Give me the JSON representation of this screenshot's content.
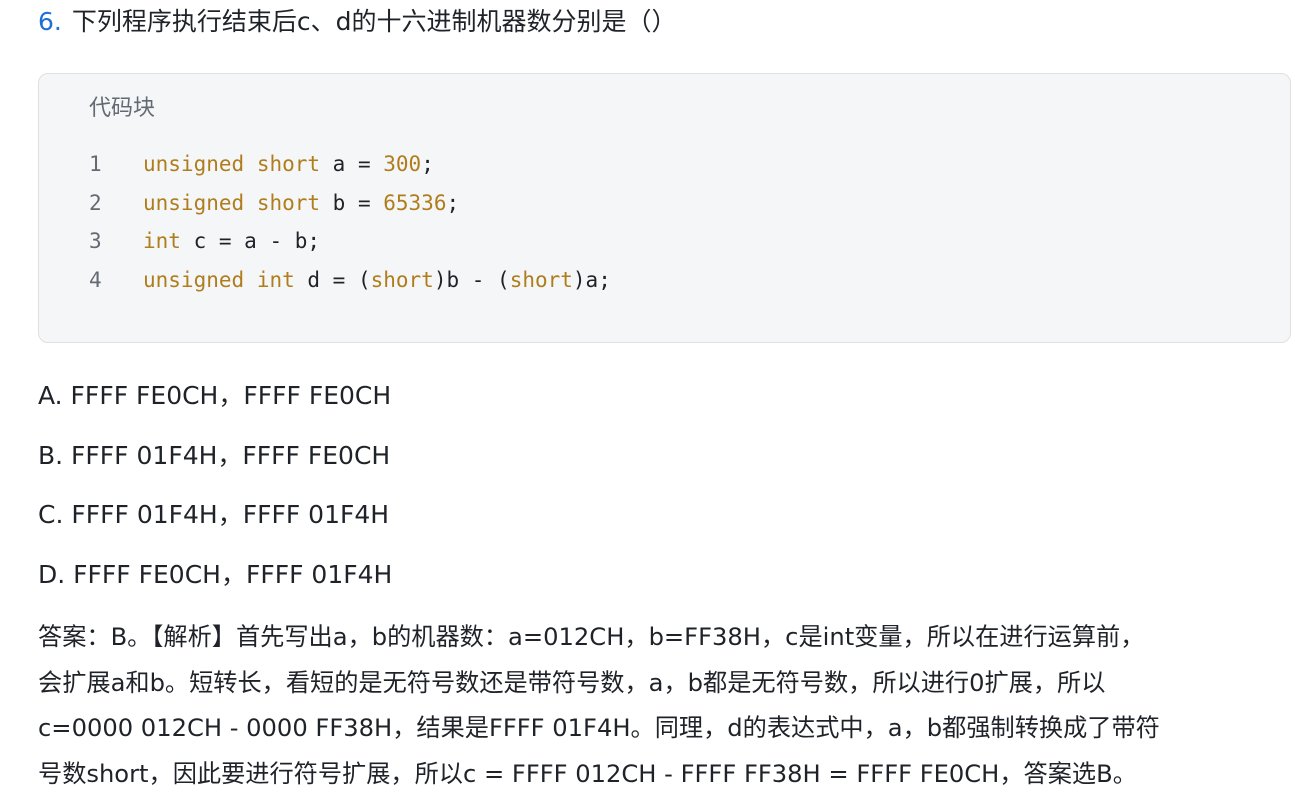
{
  "question": {
    "number": "6.",
    "text": "下列程序执行结束后c、d的十六进制机器数分别是（）"
  },
  "code_block": {
    "title": "代码块",
    "lines": [
      {
        "no": "1",
        "tokens": [
          {
            "t": "unsigned",
            "k": "kw"
          },
          {
            "t": " ",
            "k": ""
          },
          {
            "t": "short",
            "k": "kw"
          },
          {
            "t": " a = ",
            "k": ""
          },
          {
            "t": "300",
            "k": "num"
          },
          {
            "t": ";",
            "k": ""
          }
        ]
      },
      {
        "no": "2",
        "tokens": [
          {
            "t": "unsigned",
            "k": "kw"
          },
          {
            "t": " ",
            "k": ""
          },
          {
            "t": "short",
            "k": "kw"
          },
          {
            "t": " b = ",
            "k": ""
          },
          {
            "t": "65336",
            "k": "num"
          },
          {
            "t": ";",
            "k": ""
          }
        ]
      },
      {
        "no": "3",
        "tokens": [
          {
            "t": "int",
            "k": "kw"
          },
          {
            "t": " c = a - b;",
            "k": ""
          }
        ]
      },
      {
        "no": "4",
        "tokens": [
          {
            "t": "unsigned",
            "k": "kw"
          },
          {
            "t": " ",
            "k": ""
          },
          {
            "t": "int",
            "k": "kw"
          },
          {
            "t": " d = (",
            "k": ""
          },
          {
            "t": "short",
            "k": "kw"
          },
          {
            "t": ")b - (",
            "k": ""
          },
          {
            "t": "short",
            "k": "kw"
          },
          {
            "t": ")a;",
            "k": ""
          }
        ]
      }
    ]
  },
  "options": [
    "A. FFFF FE0CH，FFFF FE0CH",
    "B. FFFF 01F4H，FFFF FE0CH",
    "C. FFFF 01F4H，FFFF 01F4H",
    "D. FFFF FE0CH，FFFF 01F4H"
  ],
  "answer_lines": [
    "答案：B。【解析】首先写出a，b的机器数：a=012CH，b=FF38H，c是int变量，所以在进行运算前，",
    "会扩展a和b。短转长，看短的是无符号数还是带符号数，a，b都是无符号数，所以进行0扩展，所以",
    "c=0000 012CH - 0000 FF38H，结果是FFFF 01F4H。同理，d的表达式中，a，b都强制转换成了带符",
    "号数short，因此要进行符号扩展，所以c = FFFF 012CH - FFFF FF38H = FFFF FE0CH，答案选B。"
  ]
}
